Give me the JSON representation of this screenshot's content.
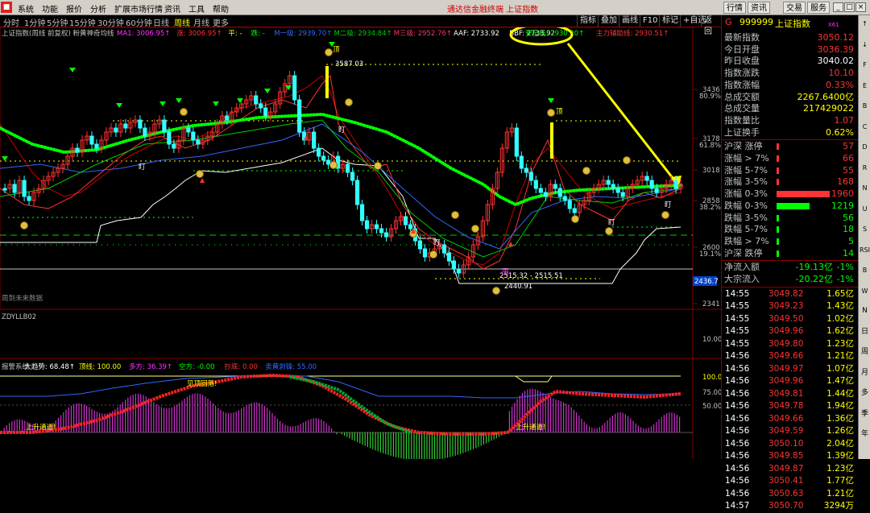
{
  "menu": {
    "items": [
      "系统",
      "功能",
      "报价",
      "分析",
      "扩展市场行情",
      "资讯",
      "工具",
      "帮助"
    ],
    "center_title": "通达信金融终端   上证指数",
    "right_buttons": [
      "行情",
      "资讯",
      "交易",
      "服务"
    ]
  },
  "tabs": {
    "items": [
      "分时",
      "1分钟",
      "5分钟",
      "15分钟",
      "30分钟",
      "60分钟",
      "日线",
      "周线",
      "月线",
      "更多"
    ],
    "active_index": 7,
    "tools": [
      "指标",
      "叠加",
      "画线",
      "F10",
      "标记",
      "+自选",
      "返回"
    ]
  },
  "main_legend": {
    "title": "上证指数(周线 前复权) 粉黄神奇均线",
    "items": [
      {
        "text": "MA1: 3006.95↑",
        "color": "#ff33ff"
      },
      {
        "text": "涨: 3006.95↑",
        "color": "#ff3333"
      },
      {
        "text": "平: -",
        "color": "#ffff00"
      },
      {
        "text": "跌: -",
        "color": "#00ff00"
      },
      {
        "text": "M一级: 2939.70↑",
        "color": "#3366ff"
      },
      {
        "text": "M二级: 2934.84↑",
        "color": "#00cc00"
      },
      {
        "text": "M三级: 2952.76↑",
        "color": "#ff3366"
      },
      {
        "text": "AAF: 2733.92",
        "color": "#ffffff"
      },
      {
        "text": "BBF: 2733.92",
        "color": "#ffffff"
      },
      {
        "text": "安全线: 2930.20↑",
        "color": "#00ff00"
      },
      {
        "text": "主力辅助线: 2930.51↑",
        "color": "#ff3333"
      }
    ]
  },
  "price_axis": [
    {
      "label": "3436",
      "sub": "80.9%"
    },
    {
      "label": "3178",
      "sub": "61.8%"
    },
    {
      "label": "3018",
      "sub": ""
    },
    {
      "label": "2858",
      "sub": "38.2%"
    },
    {
      "label": "2600",
      "sub": "19.1%"
    },
    {
      "label": "2341",
      "sub": ""
    }
  ],
  "price_tag": "2436.7",
  "annotations": {
    "top_level": "3587.03",
    "low_range": "2515.32 - 2515.51",
    "low_level": "2440.91",
    "future_note": "周到未来数据",
    "peak_mark": "顶",
    "right_peak_mark": "顶",
    "wei": "围",
    "ding": "盯"
  },
  "mid_panel": {
    "title": "ZDYLLB02",
    "axis": "10.00"
  },
  "bottom_panel": {
    "legend": [
      {
        "text": "报警系统",
        "color": "#c0c0c0"
      },
      {
        "text": "大趋势: 68.48↑",
        "color": "#ffffff"
      },
      {
        "text": "顶线: 100.00",
        "color": "#ffff00"
      },
      {
        "text": "多方: 36.39↑",
        "color": "#ff33ff"
      },
      {
        "text": "空方: -0.00",
        "color": "#00ff00"
      },
      {
        "text": "抄底: 0.00",
        "color": "#ff3333"
      },
      {
        "text": "卖黄剥锋: 55.00",
        "color": "#3366ff"
      }
    ],
    "axis": [
      "100.0",
      "75.00",
      "50.00"
    ],
    "labels": [
      "上升通道!",
      "见顶回落!",
      "上升通道!"
    ]
  },
  "quote": {
    "code": "999999",
    "name": "上证指数",
    "g_mark": "G",
    "x_mark": "X61",
    "rows": [
      {
        "label": "最新指数",
        "value": "3050.12",
        "color": "#ff3333"
      },
      {
        "label": "今日开盘",
        "value": "3036.39",
        "color": "#ff3333"
      },
      {
        "label": "昨日收盘",
        "value": "3040.02",
        "color": "#ffffff"
      },
      {
        "label": "指数涨跌",
        "value": "10.10",
        "color": "#ff3333"
      },
      {
        "label": "指数涨幅",
        "value": "0.33%",
        "color": "#ff3333"
      },
      {
        "label": "总成交额",
        "value": "2267.6400亿",
        "color": "#ffff00"
      },
      {
        "label": "总成交量",
        "value": "217429022",
        "color": "#ffff00"
      },
      {
        "label": "指数量比",
        "value": "1.07",
        "color": "#ff3333"
      },
      {
        "label": "上证换手",
        "value": "0.62%",
        "color": "#ffff00"
      }
    ],
    "breadth": [
      {
        "label": "沪深 涨停",
        "value": "57",
        "color": "#ff3333",
        "bar": 0.02
      },
      {
        "label": "涨幅 > 7%",
        "value": "66",
        "color": "#ff3333",
        "bar": 0.02
      },
      {
        "label": "涨幅 5-7%",
        "value": "55",
        "color": "#ff3333",
        "bar": 0.02
      },
      {
        "label": "涨幅 3-5%",
        "value": "168",
        "color": "#ff3333",
        "bar": 0.05
      },
      {
        "label": "涨幅 0-3%",
        "value": "1960",
        "color": "#ff3333",
        "bar": 1.0
      },
      {
        "label": "跌幅 0-3%",
        "value": "1219",
        "color": "#00ff00",
        "bar": 0.62
      },
      {
        "label": "跌幅 3-5%",
        "value": "56",
        "color": "#00ff00",
        "bar": 0.02
      },
      {
        "label": "跌幅 5-7%",
        "value": "18",
        "color": "#00ff00",
        "bar": 0.01
      },
      {
        "label": "跌幅 > 7%",
        "value": "5",
        "color": "#00ff00",
        "bar": 0.01
      },
      {
        "label": "沪深 跌停",
        "value": "14",
        "color": "#00ff00",
        "bar": 0.01
      }
    ],
    "flows": [
      {
        "label": "净流入额",
        "value": "-19.13亿",
        "pct": "-1%"
      },
      {
        "label": "大宗流入",
        "value": "-20.22亿",
        "pct": "-1%"
      }
    ]
  },
  "trades": [
    {
      "t": "14:55",
      "p": "3049.82",
      "v": "1.65亿"
    },
    {
      "t": "14:55",
      "p": "3049.23",
      "v": "1.43亿"
    },
    {
      "t": "14:55",
      "p": "3049.50",
      "v": "1.02亿"
    },
    {
      "t": "14:55",
      "p": "3049.96",
      "v": "1.62亿"
    },
    {
      "t": "14:55",
      "p": "3049.80",
      "v": "1.23亿"
    },
    {
      "t": "14:56",
      "p": "3049.66",
      "v": "1.21亿"
    },
    {
      "t": "14:56",
      "p": "3049.97",
      "v": "1.07亿"
    },
    {
      "t": "14:56",
      "p": "3049.96",
      "v": "1.47亿"
    },
    {
      "t": "14:56",
      "p": "3049.81",
      "v": "1.44亿"
    },
    {
      "t": "14:56",
      "p": "3049.78",
      "v": "1.94亿"
    },
    {
      "t": "14:56",
      "p": "3049.66",
      "v": "1.36亿"
    },
    {
      "t": "14:56",
      "p": "3049.59",
      "v": "1.26亿"
    },
    {
      "t": "14:56",
      "p": "3050.10",
      "v": "2.04亿"
    },
    {
      "t": "14:56",
      "p": "3049.85",
      "v": "1.39亿"
    },
    {
      "t": "14:56",
      "p": "3049.87",
      "v": "1.23亿"
    },
    {
      "t": "14:56",
      "p": "3050.41",
      "v": "1.77亿"
    },
    {
      "t": "14:56",
      "p": "3050.63",
      "v": "1.21亿"
    },
    {
      "t": "14:57",
      "p": "3050.70",
      "v": "3294万"
    }
  ],
  "right_tools": [
    "↑",
    "↓",
    "F",
    "E",
    "B",
    "C",
    "D",
    "R",
    "N",
    "U",
    "S",
    "RSI",
    "B",
    "W",
    "N",
    "日",
    "周",
    "月",
    "多",
    "季",
    "年"
  ]
}
